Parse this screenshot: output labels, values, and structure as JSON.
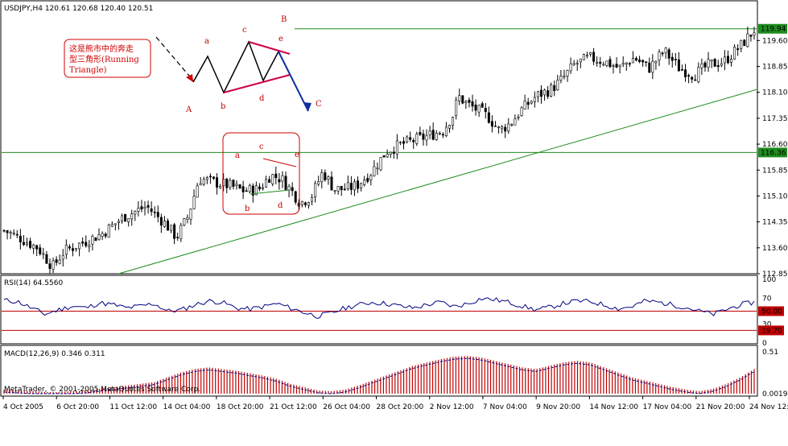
{
  "chart_data": [
    {
      "type": "candlestick",
      "symbol_header": "USDJPY,H4  120.61 120.68 120.40 120.51",
      "ohlc_last": {
        "open": 120.61,
        "high": 120.68,
        "low": 120.4,
        "close": 120.51
      },
      "ylim": [
        112.85,
        120.4
      ],
      "yticks": [
        "119.60",
        "118.85",
        "118.10",
        "117.35",
        "116.60",
        "115.85",
        "115.10",
        "114.35",
        "113.60",
        "112.85"
      ],
      "price_labels": [
        "119.94",
        "116.36"
      ],
      "horizontal_levels": [
        119.94,
        116.36
      ],
      "trendline": {
        "from": {
          "x": 0.155,
          "y": 112.85
        },
        "to": {
          "x": 1.0,
          "y": 118.18
        }
      },
      "colors": {
        "bull": "#000000",
        "bear": "#000000",
        "level": "#1e8c1e",
        "trendline": "#1e8c1e",
        "label_bg": "#1e8c1e"
      },
      "x_labels": [
        "4 Oct 2005",
        "6 Oct 20:00",
        "11 Oct 12:00",
        "14 Oct 04:00",
        "18 Oct 20:00",
        "21 Oct 12:00",
        "26 Oct 04:00",
        "28 Oct 20:00",
        "2 Nov 12:00",
        "7 Nov 04:00",
        "9 Nov 20:00",
        "14 Nov 12:00",
        "17 Nov 04:00",
        "21 Nov 20:00",
        "24 Nov 12:00"
      ],
      "close_path": [
        [
          0.0,
          114.1
        ],
        [
          0.02,
          113.9
        ],
        [
          0.045,
          113.6
        ],
        [
          0.065,
          113.05
        ],
        [
          0.08,
          113.5
        ],
        [
          0.1,
          113.7
        ],
        [
          0.13,
          114.0
        ],
        [
          0.16,
          114.5
        ],
        [
          0.19,
          114.8
        ],
        [
          0.215,
          114.3
        ],
        [
          0.23,
          113.9
        ],
        [
          0.245,
          114.5
        ],
        [
          0.26,
          115.6
        ],
        [
          0.28,
          115.5
        ],
        [
          0.3,
          115.4
        ],
        [
          0.32,
          115.25
        ],
        [
          0.34,
          115.3
        ],
        [
          0.355,
          115.7
        ],
        [
          0.37,
          115.6
        ],
        [
          0.385,
          115.2
        ],
        [
          0.395,
          114.9
        ],
        [
          0.41,
          115.1
        ],
        [
          0.425,
          115.8
        ],
        [
          0.44,
          115.3
        ],
        [
          0.455,
          115.3
        ],
        [
          0.47,
          115.4
        ],
        [
          0.49,
          115.8
        ],
        [
          0.51,
          116.4
        ],
        [
          0.53,
          116.6
        ],
        [
          0.56,
          116.8
        ],
        [
          0.585,
          117.0
        ],
        [
          0.6,
          117.5
        ],
        [
          0.605,
          118.0
        ],
        [
          0.615,
          117.8
        ],
        [
          0.63,
          117.6
        ],
        [
          0.645,
          117.4
        ],
        [
          0.66,
          117.0
        ],
        [
          0.675,
          117.2
        ],
        [
          0.69,
          117.6
        ],
        [
          0.71,
          118.0
        ],
        [
          0.73,
          118.2
        ],
        [
          0.745,
          118.5
        ],
        [
          0.76,
          118.9
        ],
        [
          0.78,
          119.1
        ],
        [
          0.8,
          119.0
        ],
        [
          0.82,
          118.8
        ],
        [
          0.84,
          119.1
        ],
        [
          0.86,
          118.8
        ],
        [
          0.88,
          119.3
        ],
        [
          0.9,
          118.8
        ],
        [
          0.92,
          118.6
        ],
        [
          0.94,
          118.9
        ],
        [
          0.96,
          119.0
        ],
        [
          0.98,
          119.4
        ],
        [
          1.0,
          119.9
        ]
      ],
      "pattern_labels": [
        "A",
        "B",
        "C",
        "a",
        "b",
        "c",
        "d",
        "e"
      ],
      "pattern_labels_inner": [
        "a",
        "b",
        "c",
        "d",
        "e"
      ],
      "annotation": "这是熊市中的奔走型三角形(Running Triangle)"
    },
    {
      "type": "line",
      "label": "RSI(14) 64.5560",
      "ylim": [
        0,
        100
      ],
      "yticks": [
        "100",
        "70",
        "30",
        "0"
      ],
      "levels": [
        50.0,
        19.7
      ],
      "level_labels": [
        "50.00",
        "19.70"
      ],
      "colors": {
        "line": "#000080",
        "level50": "#c00000",
        "level19": "#c00000"
      },
      "values": [
        67,
        65,
        55,
        45,
        52,
        58,
        55,
        63,
        60,
        55,
        58,
        62,
        50,
        52,
        60,
        66,
        64,
        55,
        53,
        57,
        62,
        55,
        48,
        42,
        47,
        55,
        60,
        64,
        62,
        58,
        55,
        60,
        64,
        57,
        62,
        70,
        68,
        64,
        58,
        52,
        56,
        62,
        66,
        65,
        60,
        54,
        57,
        66,
        64,
        60,
        56,
        50,
        45,
        53,
        60,
        64
      ]
    },
    {
      "type": "bar",
      "label": "MACD(12,26,9) 0.346 0.311",
      "footer": "MetaTrader, © 2001-2005 MetaQuotes Software Corp.",
      "yticks": [
        "0.51",
        "0.00196"
      ],
      "colors": {
        "bars": "#c00000",
        "signal": "#000080"
      },
      "values": [
        0.05,
        0.04,
        0.03,
        0.02,
        0.02,
        0.03,
        0.04,
        0.06,
        0.08,
        0.1,
        0.12,
        0.14,
        0.2,
        0.26,
        0.3,
        0.32,
        0.3,
        0.28,
        0.25,
        0.22,
        0.18,
        0.12,
        0.08,
        0.04,
        0.03,
        0.05,
        0.1,
        0.16,
        0.22,
        0.28,
        0.34,
        0.38,
        0.42,
        0.45,
        0.46,
        0.44,
        0.4,
        0.36,
        0.32,
        0.3,
        0.34,
        0.38,
        0.4,
        0.38,
        0.32,
        0.26,
        0.2,
        0.16,
        0.12,
        0.08,
        0.05,
        0.03,
        0.06,
        0.12,
        0.2,
        0.3
      ]
    }
  ]
}
